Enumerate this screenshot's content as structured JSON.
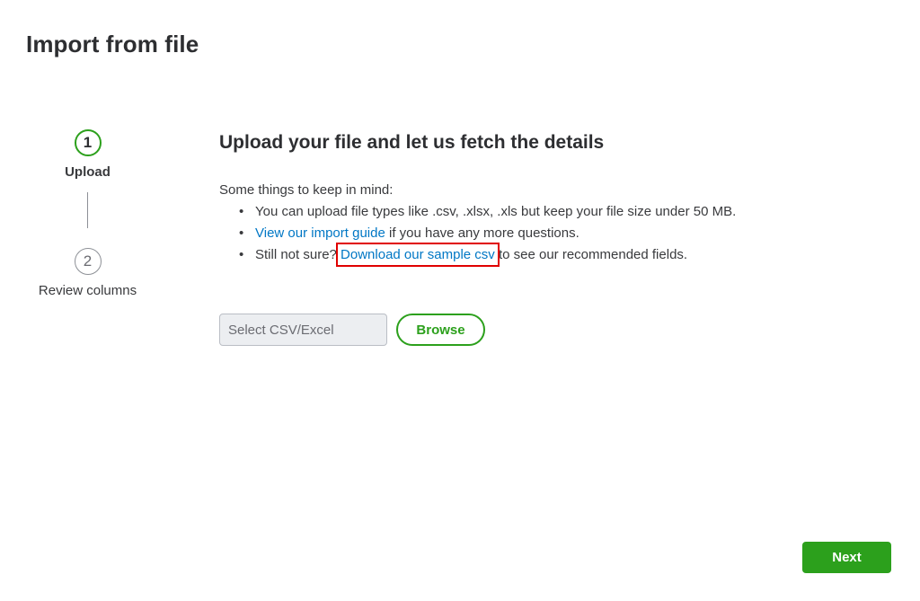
{
  "page": {
    "title": "Import from file"
  },
  "stepper": {
    "steps": [
      {
        "number": "1",
        "label": "Upload",
        "state": "active"
      },
      {
        "number": "2",
        "label": "Review columns",
        "state": "inactive"
      }
    ]
  },
  "upload_section": {
    "title": "Upload your file and let us fetch the details",
    "intro": "Some things to keep in mind:",
    "tip1": "You can upload file types like .csv, .xlsx, .xls but keep your file size under 50 MB.",
    "tip2_link": "View our import guide",
    "tip2_rest": " if you have any more questions.",
    "tip3_prefix": "Still not sure? ",
    "tip3_link": "Download our sample csv",
    "tip3_rest": " to see our recommended fields."
  },
  "file_picker": {
    "placeholder": "Select CSV/Excel",
    "browse_label": "Browse"
  },
  "footer": {
    "next_label": "Next"
  },
  "colors": {
    "accent": "#2ca01c",
    "link": "#0077c5",
    "highlight": "#e00000"
  }
}
